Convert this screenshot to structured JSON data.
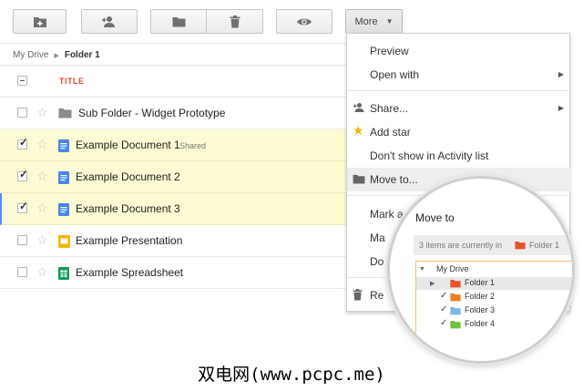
{
  "toolbar": {
    "buttons": [
      {
        "name": "new-folder",
        "icon": "folder-plus-icon"
      },
      {
        "name": "share",
        "icon": "person-add-icon"
      },
      {
        "name": "move-to-folder",
        "icon": "folder-icon"
      },
      {
        "name": "delete",
        "icon": "trash-icon"
      },
      {
        "name": "preview",
        "icon": "eye-icon"
      }
    ],
    "more_label": "More"
  },
  "breadcrumb": {
    "root": "My Drive",
    "current": "Folder 1"
  },
  "list": {
    "title_header": "TITLE",
    "rows": [
      {
        "name": "Sub Folder - Widget Prototype",
        "type": "folder",
        "selected": false,
        "badge": ""
      },
      {
        "name": "Example Document 1",
        "type": "document",
        "selected": true,
        "badge": "Shared"
      },
      {
        "name": "Example Document 2",
        "type": "document",
        "selected": true,
        "badge": ""
      },
      {
        "name": "Example Document 3",
        "type": "document",
        "selected": true,
        "badge": ""
      },
      {
        "name": "Example Presentation",
        "type": "presentation",
        "selected": false,
        "badge": ""
      },
      {
        "name": "Example Spreadsheet",
        "type": "spreadsheet",
        "selected": false,
        "badge": ""
      }
    ]
  },
  "menu": {
    "items": [
      {
        "label": "Preview"
      },
      {
        "label": "Open with"
      },
      {
        "label": "Share..."
      },
      {
        "label": "Add star"
      },
      {
        "label": "Don't show in Activity list"
      },
      {
        "label": "Move to..."
      },
      {
        "label": "Mark a"
      },
      {
        "label": "Ma"
      },
      {
        "label": "Do"
      },
      {
        "label": "Re"
      }
    ]
  },
  "move_dialog": {
    "title": "Move to",
    "info_text": "3 items are currently in",
    "info_folder": "Folder 1",
    "tree": {
      "root": "My Drive",
      "folders": [
        {
          "label": "Folder 1",
          "color": "#e8502e",
          "checked": false
        },
        {
          "label": "Folder 2",
          "color": "#f57b1f",
          "checked": true
        },
        {
          "label": "Folder 3",
          "color": "#7ab8e8",
          "checked": true
        },
        {
          "label": "Folder 4",
          "color": "#6dc140",
          "checked": true
        }
      ]
    }
  },
  "watermark": "双电网(www.pcpc.me)",
  "colors": {
    "title_red": "#dd4b39",
    "selected_row": "#fdfbd4",
    "doc_blue": "#4a86e8",
    "slides_yellow": "#f4b400",
    "sheets_green": "#0f9d58"
  }
}
